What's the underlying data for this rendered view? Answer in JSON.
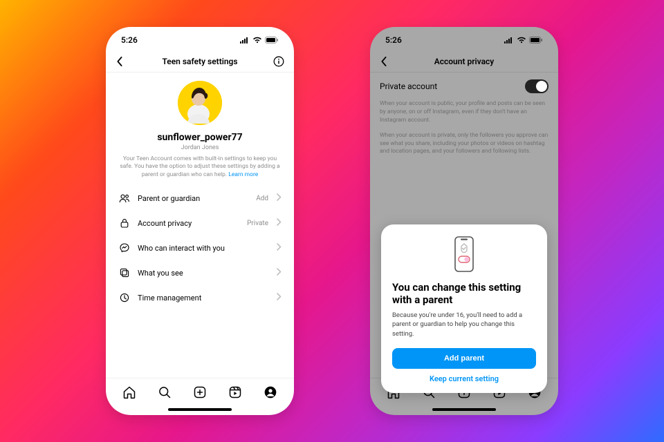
{
  "status": {
    "time": "5:26"
  },
  "left": {
    "title": "Teen safety settings",
    "username": "sunflower_power77",
    "realname": "Jordan Jones",
    "blurb": "Your Teen Account comes with built-in settings to keep you safe. You have the option to adjust these settings by adding a parent or guardian who can help.",
    "learn_more": " Learn more",
    "rows": {
      "parent": {
        "label": "Parent or guardian",
        "value": "Add"
      },
      "privacy": {
        "label": "Account privacy",
        "value": "Private"
      },
      "interact": {
        "label": "Who can interact with you"
      },
      "whatsee": {
        "label": "What you see"
      },
      "time": {
        "label": "Time management"
      }
    }
  },
  "right": {
    "title": "Account privacy",
    "private_label": "Private account",
    "para1": "When your account is public, your profile and posts can be seen by anyone, on or off Instagram, even if they don't have an Instagram account.",
    "para2": "When your account is private, only the followers you approve can see what you share, including your photos or videos on hashtag and location pages, and your followers and following lists.",
    "modal": {
      "title": "You can change this setting with a parent",
      "body": "Because you're under 16, you'll need to add a parent or guardian to help you change this setting.",
      "primary": "Add parent",
      "secondary": "Keep current setting"
    }
  }
}
